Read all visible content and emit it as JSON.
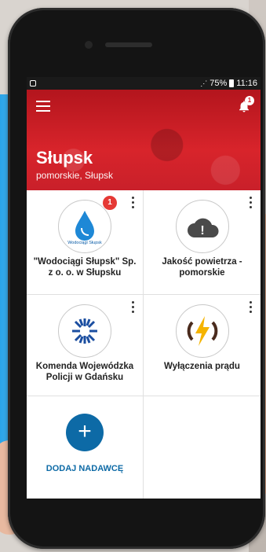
{
  "status": {
    "battery": "75%",
    "time": "11:16"
  },
  "header": {
    "city": "Słupsk",
    "region": "pomorskie, Słupsk",
    "notification_count": "1"
  },
  "cards": [
    {
      "label": "\"Wodociągi Słupsk\" Sp. z o. o. w Słupsku",
      "badge": "1",
      "logo_text": "Wodociągi Słupsk",
      "icon": "water-drop-logo"
    },
    {
      "label": "Jakość powietrza - pomorskie",
      "icon": "cloud-alert-icon"
    },
    {
      "label": "Komenda Wojewódzka Policji w Gdańsku",
      "icon": "police-star-icon"
    },
    {
      "label": "Wyłączenia prądu",
      "icon": "power-bolt-icon"
    }
  ],
  "add_sender": {
    "label": "DODAJ NADAWCĘ",
    "icon": "plus-icon"
  },
  "colors": {
    "header_red": "#d8242b",
    "accent_blue": "#0d6aa6",
    "badge_red": "#e53935"
  }
}
